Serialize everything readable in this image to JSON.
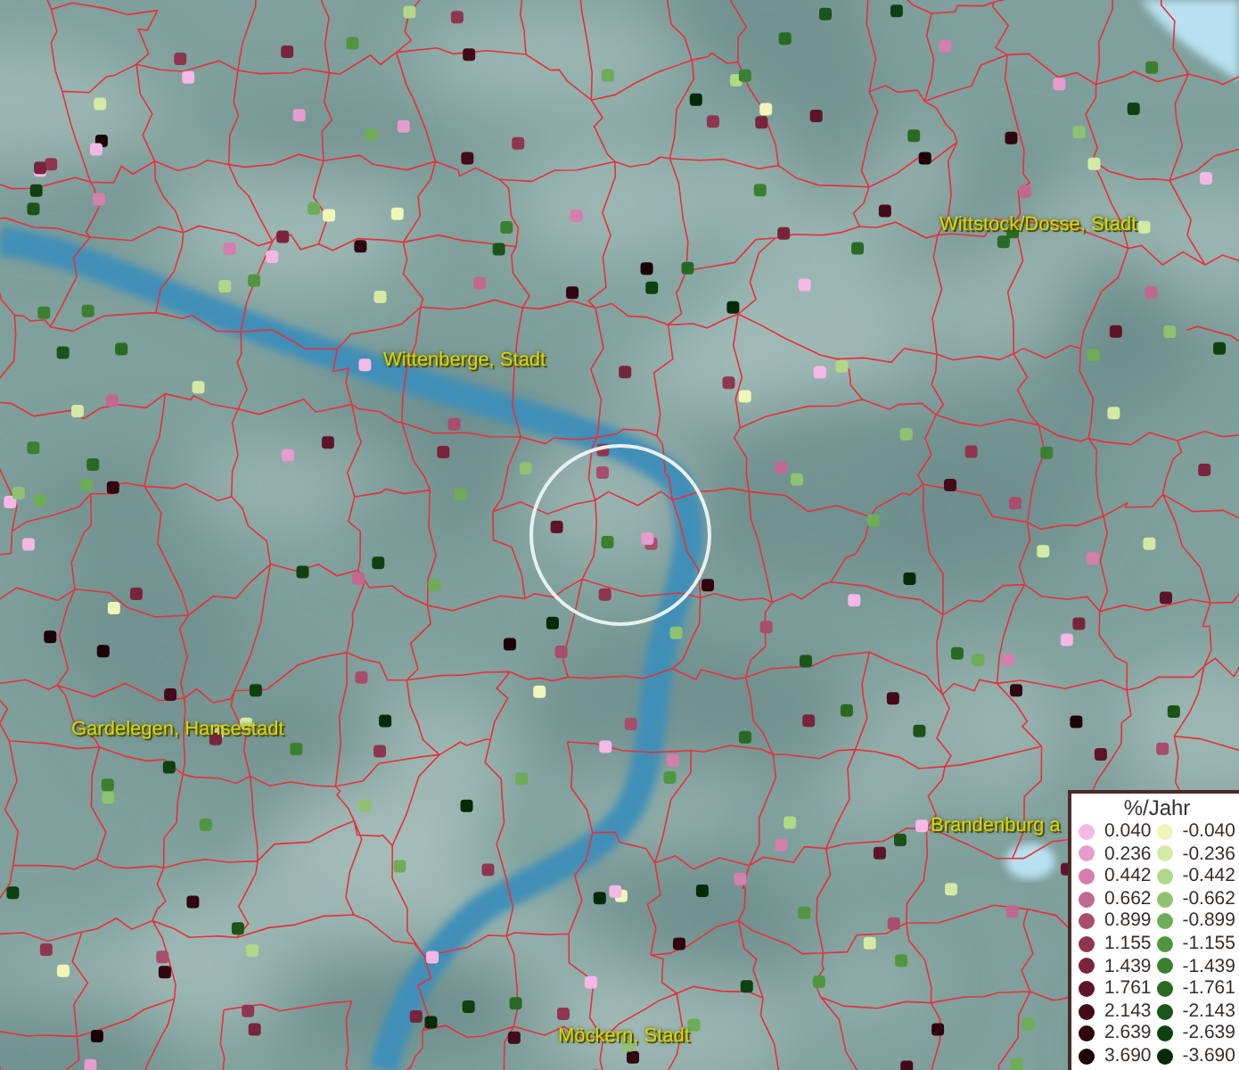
{
  "map": {
    "places": [
      {
        "name": "Wittstock/Dosse, Stadt"
      },
      {
        "name": "Wittenberge, Stadt"
      },
      {
        "name": "Gardelegen, Hansestadt"
      },
      {
        "name": "Brandenburg a"
      },
      {
        "name": "Möckern, Stadt"
      }
    ]
  },
  "legend": {
    "title": "%/Jahr",
    "positive": [
      {
        "value": "0.040",
        "color": "#f5b8e6"
      },
      {
        "value": "0.236",
        "color": "#e69ccc"
      },
      {
        "value": "0.442",
        "color": "#d47fae"
      },
      {
        "value": "0.662",
        "color": "#c26890"
      },
      {
        "value": "0.899",
        "color": "#a94d6c"
      },
      {
        "value": "1.155",
        "color": "#903550"
      },
      {
        "value": "1.439",
        "color": "#78243c"
      },
      {
        "value": "1.761",
        "color": "#5e1428"
      },
      {
        "value": "2.143",
        "color": "#450a1a"
      },
      {
        "value": "2.639",
        "color": "#300510"
      },
      {
        "value": "3.690",
        "color": "#1c0208"
      }
    ],
    "negative": [
      {
        "value": "-0.040",
        "color": "#f0f6b8"
      },
      {
        "value": "-0.236",
        "color": "#d4eaa4"
      },
      {
        "value": "-0.442",
        "color": "#b0d888"
      },
      {
        "value": "-0.662",
        "color": "#8ec270"
      },
      {
        "value": "-0.899",
        "color": "#6eac58"
      },
      {
        "value": "-1.155",
        "color": "#509640"
      },
      {
        "value": "-1.439",
        "color": "#3a8030"
      },
      {
        "value": "-1.761",
        "color": "#286a22"
      },
      {
        "value": "-2.143",
        "color": "#1a5418"
      },
      {
        "value": "-2.639",
        "color": "#0e4010"
      },
      {
        "value": "-3.690",
        "color": "#062a08"
      }
    ]
  }
}
